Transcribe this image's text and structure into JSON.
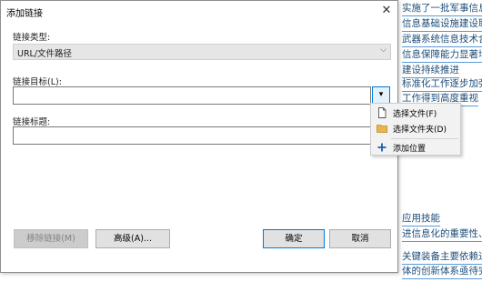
{
  "dialog": {
    "title": "添加链接",
    "close_glyph": "✕",
    "link_type_label": "链接类型:",
    "link_type_value": "URL/文件路径",
    "link_target_label": "链接目标(L):",
    "link_title_label": "链接标题:",
    "dropdown_glyph": "▾",
    "buttons": {
      "remove": "移除链接(M)",
      "advanced": "高级(A)...",
      "ok": "确定",
      "cancel": "取消"
    }
  },
  "menu": {
    "items": [
      {
        "label": "选择文件(F)",
        "icon": "file-icon"
      },
      {
        "label": "选择文件夹(D)",
        "icon": "folder-icon"
      },
      {
        "label": "添加位置",
        "icon": "plus-icon"
      }
    ]
  },
  "background_doc": {
    "lines": [
      "实施了一批军事信息系",
      "信息基础设施建设取得",
      "武器系统信息技术含量",
      "信息保障能力显著增强",
      "建设持续推进",
      "标准化工作逐步加强",
      "工作得到高度重视",
      "应用技能",
      "进信息化的重要性、",
      "关键装备主要依赖进",
      "体的创新体系亟待完"
    ]
  },
  "colors": {
    "accent": "#0078d7",
    "link_text": "#1f4e79",
    "link_underline": "#5b9bd5"
  }
}
